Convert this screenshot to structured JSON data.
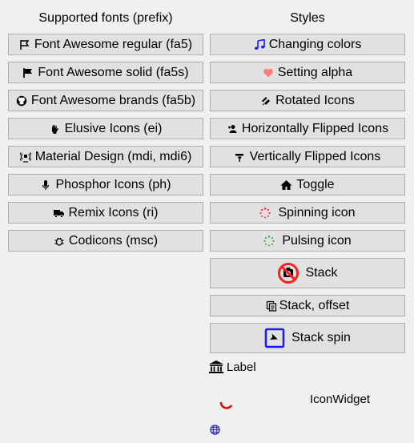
{
  "left_column": {
    "title": "Supported fonts (prefix)",
    "buttons": [
      {
        "label": "Font Awesome regular (fa5)",
        "icon": "flag-outline-icon"
      },
      {
        "label": "Font Awesome solid (fa5s)",
        "icon": "flag-solid-icon"
      },
      {
        "label": "Font Awesome brands (fa5b)",
        "icon": "github-icon"
      },
      {
        "label": "Elusive Icons (ei)",
        "icon": "hand-rock-icon"
      },
      {
        "label": "Material Design (mdi, mdi6)",
        "icon": "broadcast-icon"
      },
      {
        "label": "Phosphor Icons (ph)",
        "icon": "microphone-icon"
      },
      {
        "label": "Remix Icons (ri)",
        "icon": "truck-icon"
      },
      {
        "label": "Codicons (msc)",
        "icon": "debug-icon"
      }
    ]
  },
  "right_column": {
    "title": "Styles",
    "buttons": [
      {
        "label": "Changing colors",
        "icon": "music-note-icon"
      },
      {
        "label": "Setting alpha",
        "icon": "heart-icon"
      },
      {
        "label": "Rotated Icons",
        "icon": "rotated-pen-icon"
      },
      {
        "label": "Horizontally Flipped Icons",
        "icon": "user-flipped-icon"
      },
      {
        "label": "Vertically Flipped Icons",
        "icon": "pen-flipped-icon"
      },
      {
        "label": "Toggle",
        "icon": "home-icon"
      },
      {
        "label": "Spinning icon",
        "icon": "spinner-icon"
      },
      {
        "label": "Pulsing icon",
        "icon": "pulse-spinner-icon"
      },
      {
        "label": "Stack",
        "icon": "camera-ban-icon"
      },
      {
        "label": "Stack, offset",
        "icon": "stacked-copy-icon"
      },
      {
        "label": "Stack spin",
        "icon": "square-spin-icon"
      }
    ],
    "label_widget": {
      "text": "Label",
      "icon": "bank-icon"
    },
    "icon_widget": {
      "text": "IconWidget",
      "icon": "spinner-arc-icon"
    },
    "globe": {
      "icon": "globe-icon"
    }
  },
  "colors": {
    "music": "#1a1aff",
    "heart": "#ff6b6b",
    "spinner": "#ff3030",
    "pulse": "#30a030",
    "stack_ban": "#ff2020",
    "stack_spin_frame": "#1c1ce0",
    "icon_widget_arc": "#e00000",
    "globe": "#2020c0"
  }
}
